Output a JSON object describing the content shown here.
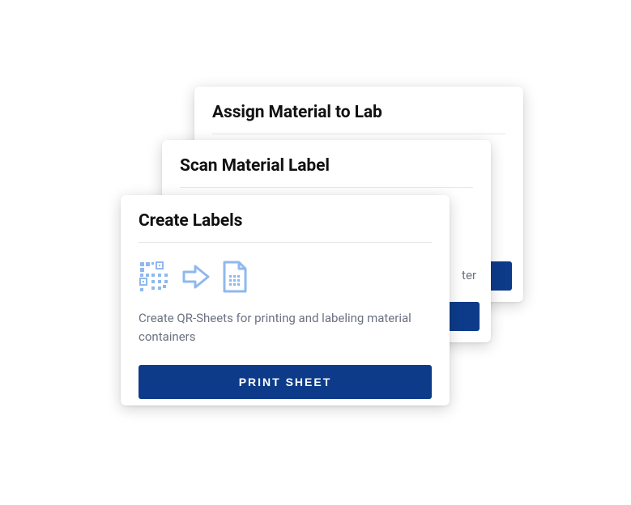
{
  "cards": {
    "back": {
      "title": "Assign Material to Lab"
    },
    "mid": {
      "title": "Scan Material Label",
      "fragment": "ter"
    },
    "front": {
      "title": "Create Labels",
      "description": "Create QR-Sheets for printing and labeling material containers",
      "button": "PRINT SHEET"
    }
  }
}
